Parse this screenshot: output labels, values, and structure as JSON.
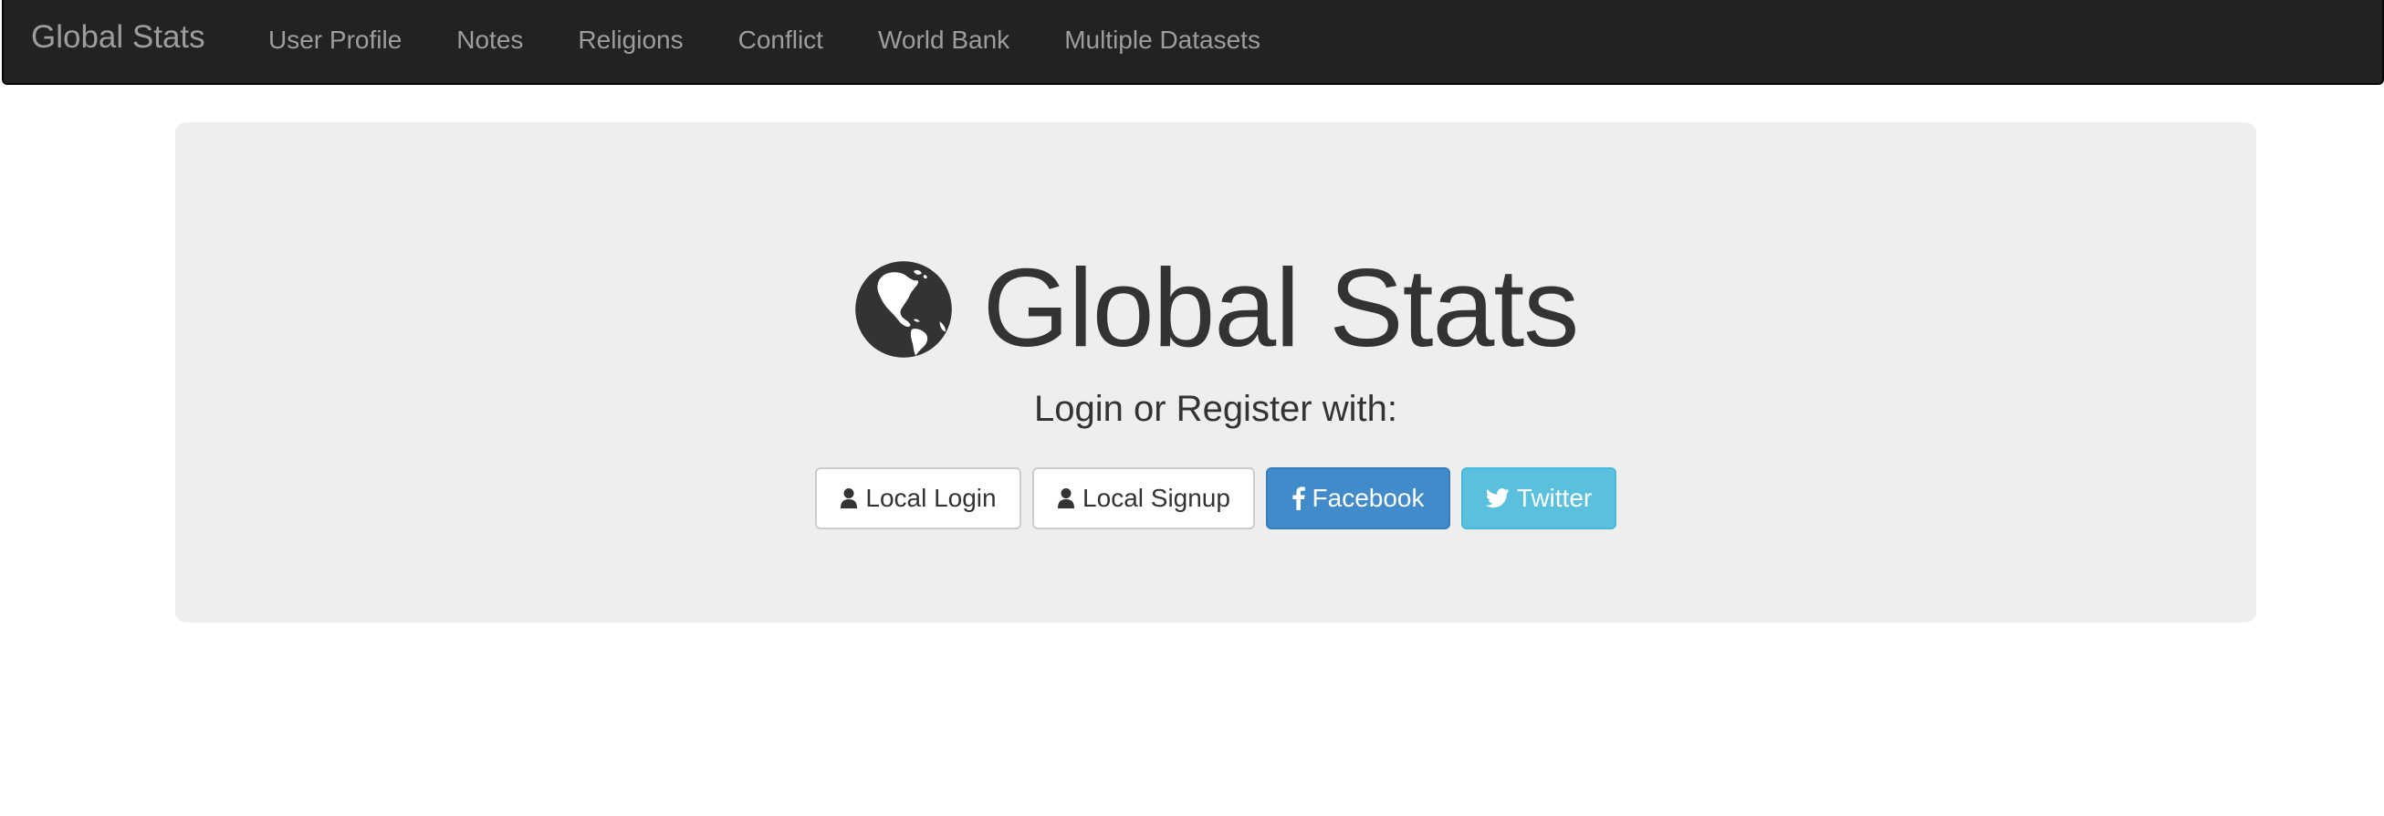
{
  "navbar": {
    "brand": "Global Stats",
    "items": [
      {
        "label": "User Profile"
      },
      {
        "label": "Notes"
      },
      {
        "label": "Religions"
      },
      {
        "label": "Conflict"
      },
      {
        "label": "World Bank"
      },
      {
        "label": "Multiple Datasets"
      }
    ]
  },
  "hero": {
    "icon": "globe-icon",
    "title": "Global Stats",
    "subtitle": "Login or Register with:"
  },
  "buttons": {
    "local_login": {
      "label": "Local Login",
      "icon": "user-icon"
    },
    "local_signup": {
      "label": "Local Signup",
      "icon": "user-icon"
    },
    "facebook": {
      "label": "Facebook",
      "icon": "facebook-icon"
    },
    "twitter": {
      "label": "Twitter",
      "icon": "twitter-icon"
    }
  },
  "colors": {
    "navbar_bg": "#222222",
    "nav_text": "#9d9d9d",
    "jumbotron_bg": "#eeeeee",
    "facebook_blue": "#428bca",
    "twitter_blue": "#5bc0de",
    "text_dark": "#333333"
  }
}
